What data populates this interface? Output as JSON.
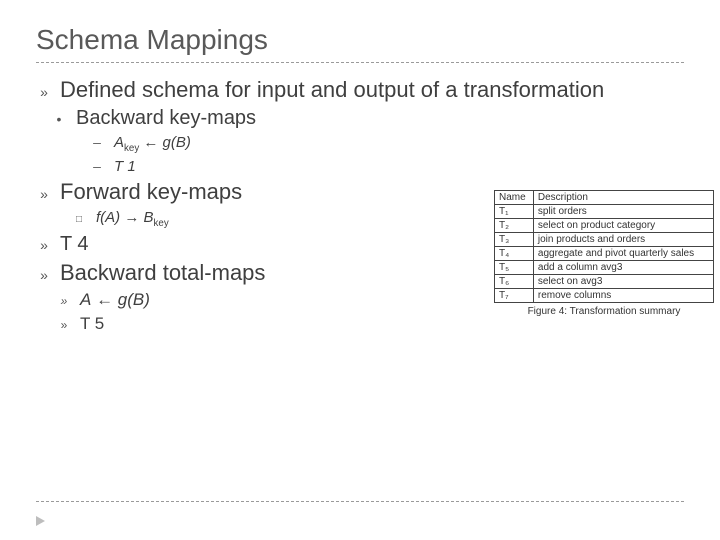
{
  "title": "Schema Mappings",
  "bullets": {
    "l0a": "Defined schema for input and output of a transformation",
    "l1a": "Backward key-maps",
    "l2a_pre": "A",
    "l2a_sub": "key",
    "l2a_mid": " ← ",
    "l2a_post": "g(B)",
    "l2b": "T 1",
    "l0b": "Forward key-maps",
    "l2c_pre": "f(A)",
    "l2c_mid": " → ",
    "l2c_post": "B",
    "l2c_sub": "key",
    "l1c": "T 4",
    "l0c": "Backward total-maps",
    "l2d_pre": "A",
    "l2d_mid": " ← ",
    "l2d_post": "g(B)",
    "l2e": "T 5"
  },
  "glyphs": {
    "arrowish": "»",
    "dot": "•",
    "dash": "–",
    "box": "□"
  },
  "figure": {
    "headers": [
      "Name",
      "Description"
    ],
    "rows": [
      [
        "T₁",
        "split orders"
      ],
      [
        "T₂",
        "select on product category"
      ],
      [
        "T₃",
        "join products and orders"
      ],
      [
        "T₄",
        "aggregate and pivot quarterly sales"
      ],
      [
        "T₅",
        "add a column avg3"
      ],
      [
        "T₆",
        "select on avg3"
      ],
      [
        "T₇",
        "remove columns"
      ]
    ],
    "caption": "Figure 4: Transformation summary"
  }
}
